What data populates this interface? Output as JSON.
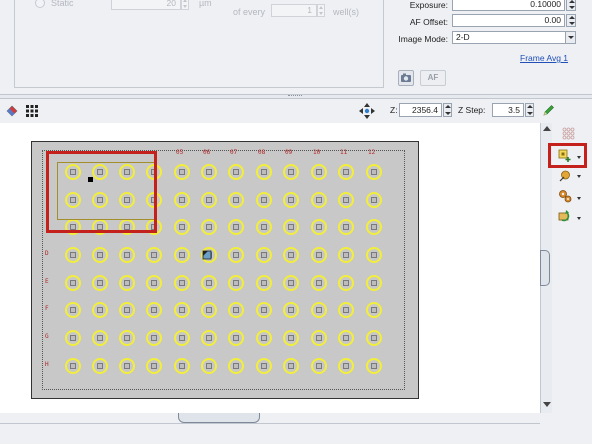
{
  "acquisition": {
    "mode_label": "Static",
    "count_value": "20",
    "unit": "µm",
    "every_label": "of every",
    "every_value": "1",
    "wells_label": "well(s)"
  },
  "camera_panel": {
    "exposure_label": "Exposure:",
    "exposure_value": "0.10000",
    "af_offset_label": "AF Offset:",
    "af_offset_value": "0.00",
    "image_mode_label": "Image Mode:",
    "image_mode_value": "2-D",
    "frame_avg_link": "Frame Avg 1",
    "af_button": "AF"
  },
  "toolbar": {
    "z_label": "Z:",
    "z_value": "2356.4",
    "zstep_label": "Z Step:",
    "zstep_value": "3.5"
  },
  "plate": {
    "col_labels": [
      "05",
      "06",
      "07",
      "08",
      "09",
      "10",
      "11",
      "12"
    ],
    "row_labels": [
      "D",
      "E",
      "F",
      "G",
      "H"
    ]
  },
  "colors": {
    "highlight": "#c4201c",
    "well_ring": "#f2ee3a",
    "plate_bg": "#c8c8c8",
    "label_red": "#b22525",
    "link": "#1f4fb7"
  },
  "icons": [
    "eraser-icon",
    "grid-icon",
    "navigate-arrows-icon",
    "pencil-icon",
    "grid-dots-icon",
    "add-site-icon",
    "pin-icon",
    "gears-icon",
    "refresh-icon",
    "camera-icon"
  ]
}
